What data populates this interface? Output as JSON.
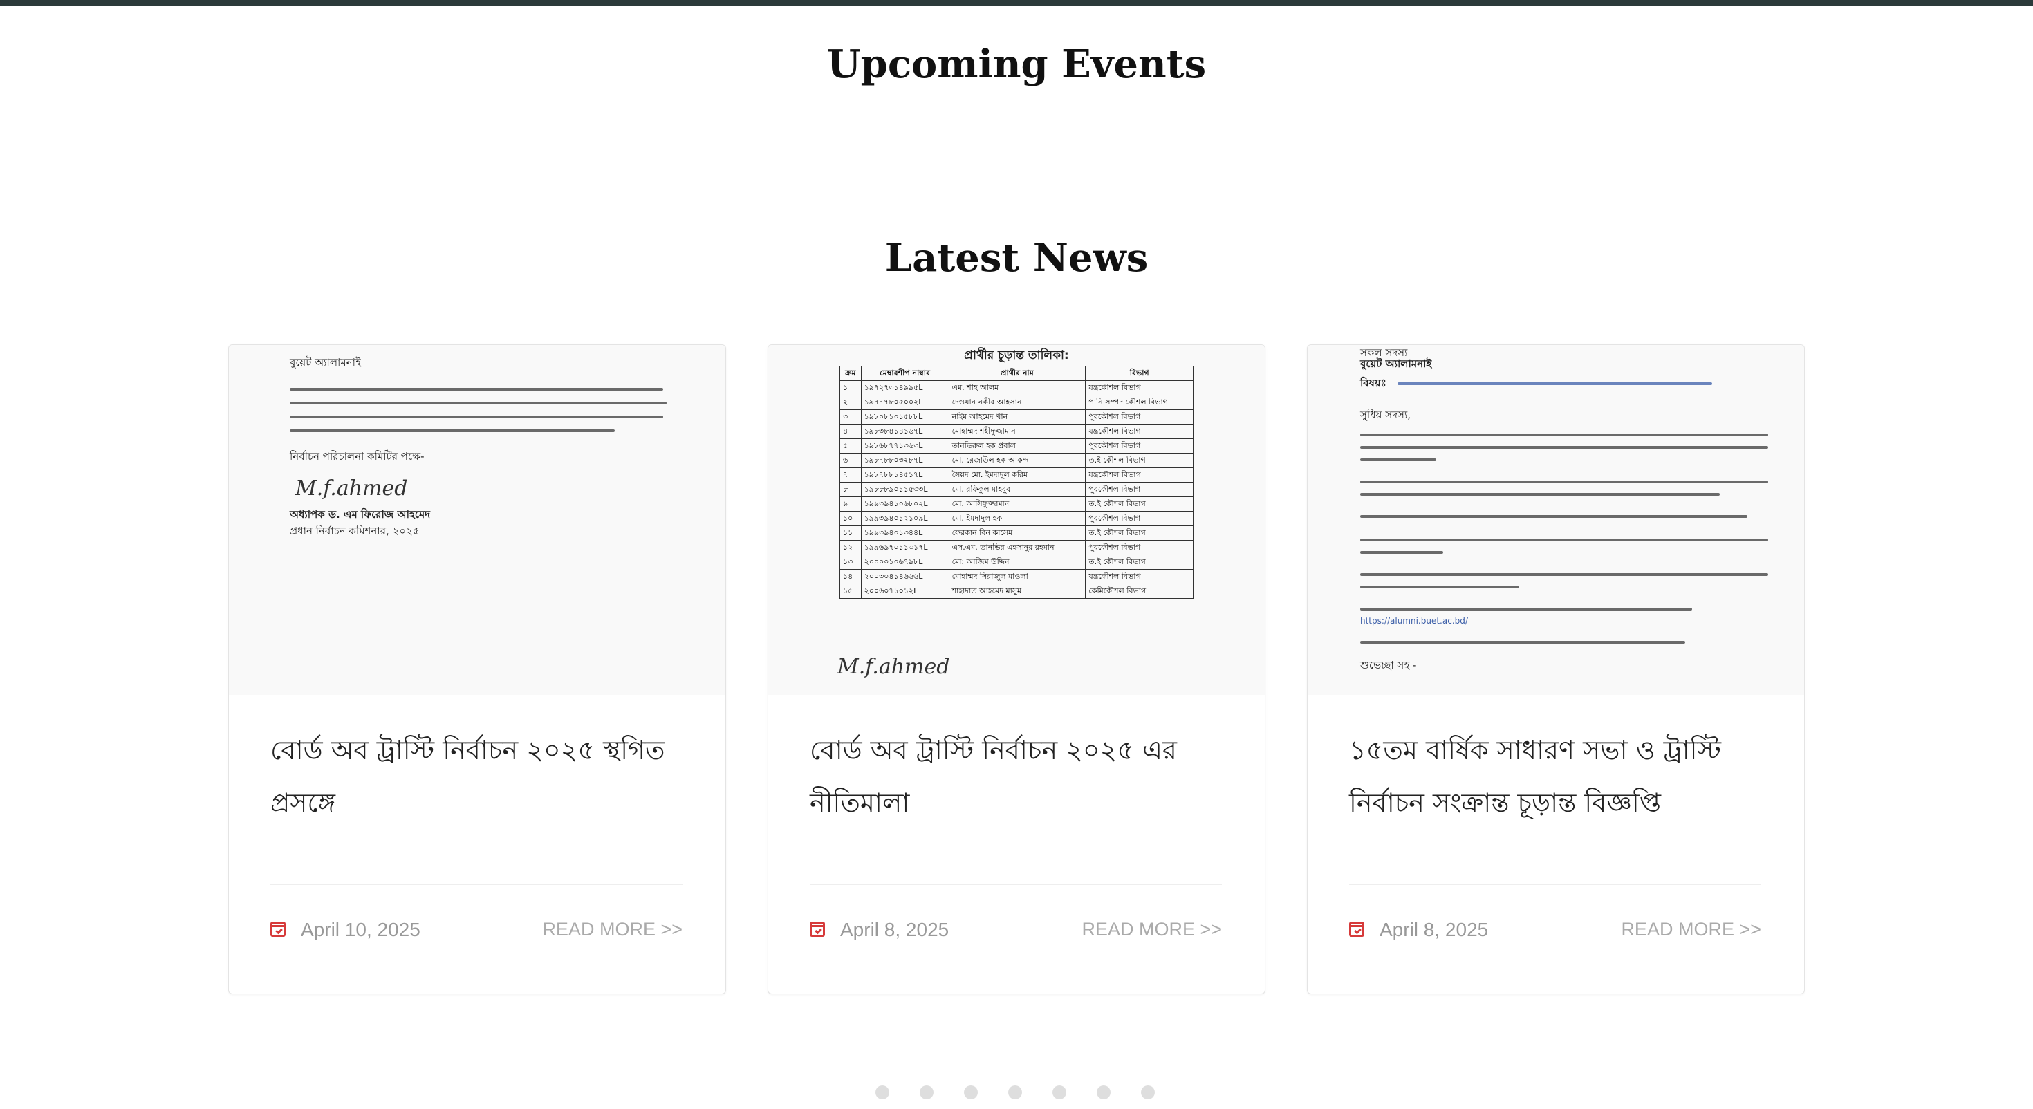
{
  "events": {
    "title": "Upcoming Events"
  },
  "news": {
    "title": "Latest News",
    "read_more_label": "READ MORE >>",
    "items": [
      {
        "title": "বোর্ড অব ট্রাস্টি নির্বাচন ২০২৫ স্থগিত প্রসঙ্গে",
        "date": "April 10, 2025",
        "thumb_text": {
          "to": "বুয়েট অ্যালামনাই",
          "sign_by": "অধ্যাপক ড. এম ফিরোজ আহমেদ",
          "sign_role": "প্রধান নির্বাচন কমিশনার, ২০২৫",
          "committee": "নির্বাচন পরিচালনা কমিটির পক্ষে-",
          "signature": "M.f.ahmed"
        }
      },
      {
        "title": "বোর্ড অব ট্রাস্টি নির্বাচন ২০২৫ এর নীতিমালা",
        "date": "April 8, 2025",
        "thumb_text": {
          "heading": "প্রার্থীর চূড়ান্ত তালিকা:",
          "col_sl": "ক্রম",
          "col_member": "মেম্বারশীপ নাম্বার",
          "col_name": "প্রার্থীর নাম",
          "col_dept": "বিভাগ",
          "rows": [
            [
              "১",
              "১৯৭২৭৩১৪৯৯৫L",
              "এম. শাহ আলম",
              "যন্ত্রকৌশল বিভাগ"
            ],
            [
              "২",
              "১৯৭৭৭৮০৫০০২L",
              "দেওয়ান নকীব আহসান",
              "পানি সম্পদ কৌশল বিভাগ"
            ],
            [
              "৩",
              "১৯৮০৮১০১৫৮৮L",
              "নাইম আহমেদ খান",
              "পুরকৌশল বিভাগ"
            ],
            [
              "৪",
              "১৯৮৩৮৪১৪১৬৭L",
              "মোহাম্মদ শহীদুজ্জামান",
              "যন্ত্রকৌশল বিভাগ"
            ],
            [
              "৫",
              "১৯৮৬৮৭৭১৩৬৩L",
              "তানভিরুল হক প্রবাল",
              "পুরকৌশল বিভাগ"
            ],
            [
              "৬",
              "১৯৮৭৮৮০৩২৮৭L",
              "মো. রেজাউল হক আকন্দ",
              "ত.ই কৌশল বিভাগ"
            ],
            [
              "৭",
              "১৯৮৭৮৮১৪৫১৭L",
              "সৈয়দ মো. ইমদাদুল করিম",
              "যন্ত্রকৌশল বিভাগ"
            ],
            [
              "৮",
              "১৯৮৮৮৯০১১৫৩৩L",
              "মো. রফিকুল মাহবুব",
              "পুরকৌশল বিভাগ"
            ],
            [
              "৯",
              "১৯৯৩৯৪১০৬৮০২L",
              "মো. আসিফুজ্জামান",
              "ত.ই কৌশল বিভাগ"
            ],
            [
              "১০",
              "১৯৯৩৯৪০১২১০৯L",
              "মো. ইমদাদুল হক",
              "পুরকৌশল বিভাগ"
            ],
            [
              "১১",
              "১৯৯৩৯৪০১৩৪৪L",
              "ফেরকান বিন কাসেম",
              "ত.ই কৌশল বিভাগ"
            ],
            [
              "১২",
              "১৯৯৬৯৭০১১৩১৭L",
              "এস.এম. তানভির এহসানুর রহমান",
              "পুরকৌশল বিভাগ"
            ],
            [
              "১৩",
              "২০০০০১০৬৭৯৮L",
              "মো: আজিম উদ্দিন",
              "ত.ই কৌশল বিভাগ"
            ],
            [
              "১৪",
              "২০০৩০৪১৪৬৬৬L",
              "মোহাম্মদ সিরাজুল মাওলা",
              "যন্ত্রকৌশল বিভাগ"
            ],
            [
              "১৫",
              "২০০৬০৭১০১২L",
              "শাহাদাত আহমেদ মাসুম",
              "কেমিকৌশল বিভাগ"
            ]
          ],
          "signature": "M.f.ahmed"
        }
      },
      {
        "title": "১৫তম বার্ষিক সাধারণ সভা ও ট্রাস্টি নির্বাচন সংক্রান্ত চূড়ান্ত বিজ্ঞপ্তি",
        "date": "April 8, 2025",
        "thumb_text": {
          "to": "সকল সদস্য",
          "org": "বুয়েট অ্যালামনাই",
          "subject_label": "বিষয়ঃ",
          "greeting": "সুধিয় সদস্য,",
          "link": "https://alumni.buet.ac.bd/",
          "closing": "শুভেচ্ছা সহ -"
        }
      }
    ]
  },
  "pager": {
    "count": 7
  },
  "colors": {
    "accent": "#d63a3a",
    "topbar": "#2b3a3a",
    "muted": "#999999"
  }
}
